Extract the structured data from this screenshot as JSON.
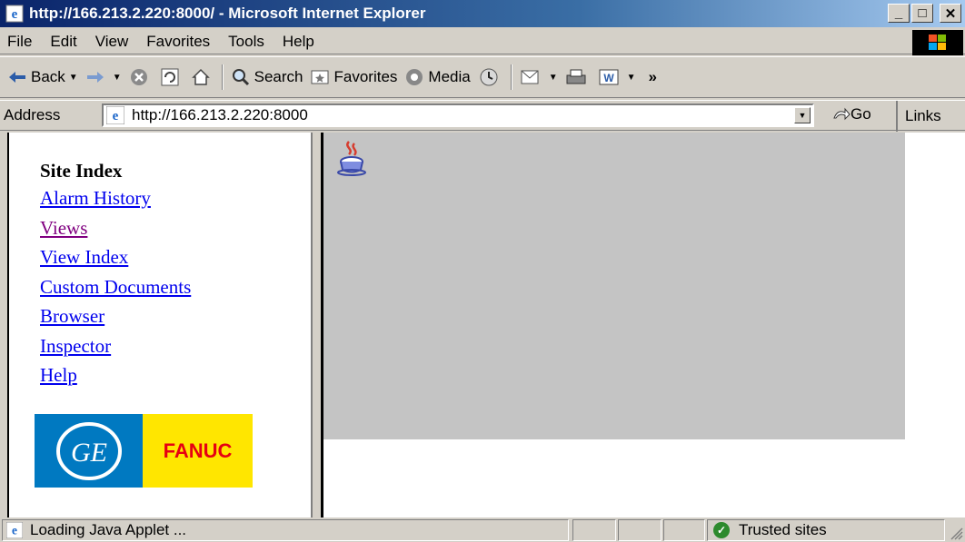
{
  "window": {
    "title": "http://166.213.2.220:8000/ - Microsoft Internet Explorer",
    "minimize": "_",
    "maximize": "□",
    "close": "✕"
  },
  "menu": {
    "items": [
      "File",
      "Edit",
      "View",
      "Favorites",
      "Tools",
      "Help"
    ]
  },
  "toolbar": {
    "back": "Back",
    "search": "Search",
    "favorites": "Favorites",
    "media": "Media",
    "overflow": "»"
  },
  "address": {
    "label": "Address",
    "url": "http://166.213.2.220:8000",
    "go": "Go",
    "links": "Links"
  },
  "sidebar": {
    "heading": "Site Index",
    "links": [
      {
        "label": "Alarm History",
        "visited": false
      },
      {
        "label": "Views",
        "visited": true
      },
      {
        "label": "View Index",
        "visited": false
      },
      {
        "label": "Custom Documents",
        "visited": false
      },
      {
        "label": "Browser",
        "visited": false
      },
      {
        "label": "Inspector",
        "visited": false
      },
      {
        "label": "Help",
        "visited": false
      }
    ],
    "logo": {
      "ge": "GE",
      "fanuc": "FANUC"
    }
  },
  "status": {
    "message": "Loading Java Applet ...",
    "zone": "Trusted sites"
  },
  "colors": {
    "titlebar_start": "#0a246a",
    "link": "#0000ee",
    "visited_link": "#800080",
    "applet_bg": "#c4c4c4",
    "ge_blue": "#0079c1",
    "fanuc_yellow": "#ffe600",
    "fanuc_red": "#e60012"
  },
  "icons": [
    "ie-icon",
    "windows-logo-icon",
    "back-arrow-icon",
    "forward-arrow-icon",
    "stop-icon",
    "refresh-icon",
    "home-icon",
    "search-icon",
    "favorites-icon",
    "media-icon",
    "history-icon",
    "mail-icon",
    "print-icon",
    "edit-icon",
    "go-arrow-icon",
    "java-icon",
    "trusted-check-icon",
    "resize-grip-icon"
  ]
}
